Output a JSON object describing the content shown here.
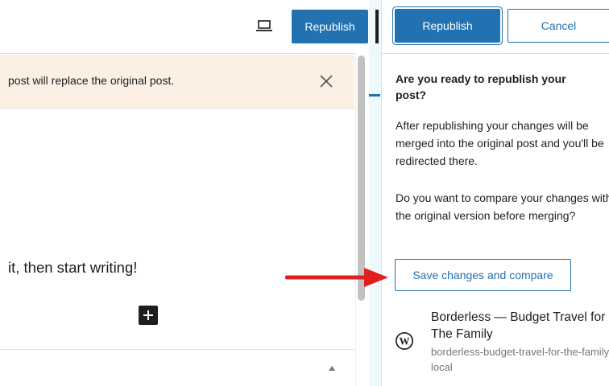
{
  "header": {
    "device_icon": "laptop-icon",
    "republish_label": "Republish"
  },
  "notice": {
    "text": "post will replace the original post.",
    "close_icon": "close-icon"
  },
  "editor": {
    "content_text": "it, then start writing!",
    "add_block_icon": "plus-icon"
  },
  "sidebar": {
    "republish_label": "Republish",
    "cancel_label": "Cancel",
    "heading": "Are you ready to republish your post?",
    "paragraph1": "After republishing your changes will be merged into the original post and you'll be redirected there.",
    "paragraph2": "Do you want to compare your changes with the original version before merging?",
    "compare_button_label": "Save changes and compare",
    "site": {
      "icon": "wordpress-icon",
      "name": "Borderless — Budget Travel for The Family",
      "url": "borderless-budget-travel-for-the-family.local"
    }
  },
  "annotation": {
    "arrow_color": "#e02020"
  },
  "colors": {
    "accent": "#2271b1",
    "notice_bg": "#fcf0e5",
    "page_bg": "#eef9fc"
  }
}
